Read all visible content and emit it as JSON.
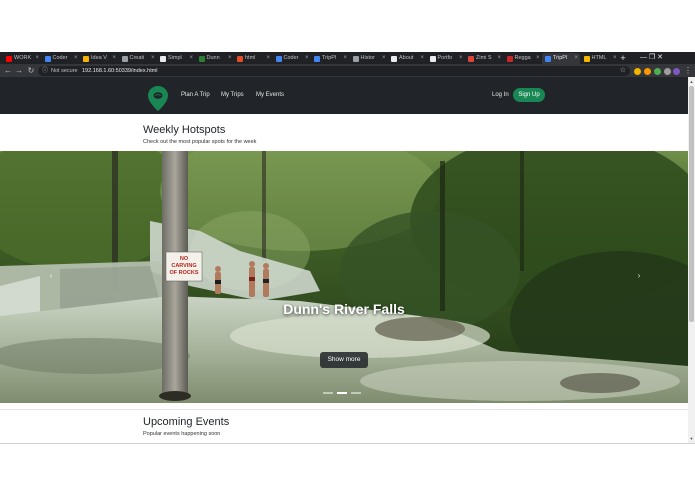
{
  "browser": {
    "tabs": [
      {
        "label": "WORK",
        "color": "#ff0000"
      },
      {
        "label": "Coder",
        "color": "#4285f4"
      },
      {
        "label": "Idea V",
        "color": "#f4b400"
      },
      {
        "label": "Creati",
        "color": "#9aa0a6"
      },
      {
        "label": "Simpl",
        "color": "#e8eaed"
      },
      {
        "label": "Dunn",
        "color": "#2e7d32"
      },
      {
        "label": "html",
        "color": "#e44d26"
      },
      {
        "label": "Coder",
        "color": "#4285f4"
      },
      {
        "label": "TripPl",
        "color": "#4285f4"
      },
      {
        "label": "Histor",
        "color": "#9aa0a6"
      },
      {
        "label": "About",
        "color": "#e8eaed"
      },
      {
        "label": "Portfo",
        "color": "#e8eaed"
      },
      {
        "label": "Zimi S",
        "color": "#db4437"
      },
      {
        "label": "Regga",
        "color": "#c62828"
      },
      {
        "label": "TripPl",
        "color": "#4285f4",
        "active": true
      },
      {
        "label": "HTML",
        "color": "#f4b400"
      }
    ],
    "tab_close": "×",
    "new_tab": "+",
    "window_controls": "—  ❐  ✕",
    "not_secure": "Not secure",
    "url": "192.168.1.60:50339/index.html",
    "menu": "⋮"
  },
  "navbar": {
    "links": [
      "Plan A Trip",
      "My Trips",
      "My Events"
    ],
    "login": "Log In",
    "signup": "Sign Up",
    "brand_color": "#198754"
  },
  "hotspots": {
    "title": "Weekly Hotspots",
    "subtitle": "Check out the most popular spots for the week"
  },
  "carousel": {
    "caption": "Dunn's River Falls",
    "sign_text": [
      "NO",
      "CARVING",
      "OF ROCKS"
    ],
    "button": "Show more",
    "prev": "‹",
    "next": "›",
    "slides": 3,
    "active_slide": 2
  },
  "events": {
    "title": "Upcoming Events",
    "subtitle": "Popular events happening soon"
  }
}
